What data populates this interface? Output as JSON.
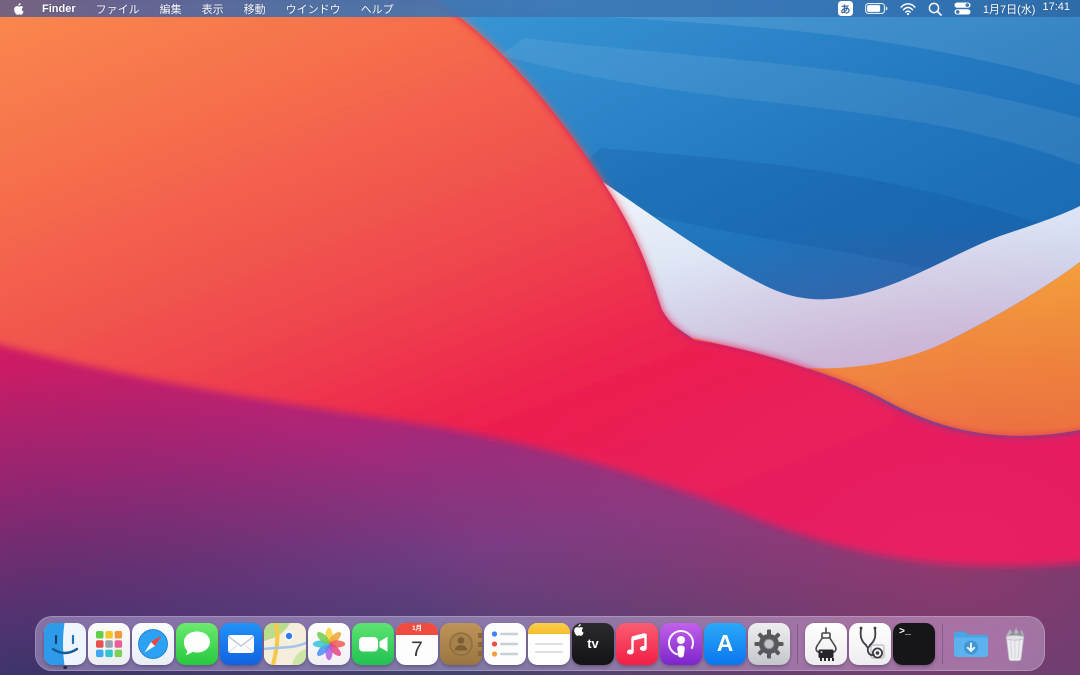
{
  "menu_bar": {
    "app_name": "Finder",
    "menus": [
      "ファイル",
      "編集",
      "表示",
      "移動",
      "ウインドウ",
      "ヘルプ"
    ],
    "status": {
      "input_source_label": "あ",
      "icons": [
        "battery-icon",
        "wifi-icon",
        "spotlight-search-icon",
        "control-center-icon"
      ],
      "battery_level_percent": 80,
      "date": "1月7日(水)",
      "time": "17:41"
    }
  },
  "dock": {
    "apps": [
      {
        "name": "Finder",
        "running": true
      },
      {
        "name": "Launchpad"
      },
      {
        "name": "Safari"
      },
      {
        "name": "Messages"
      },
      {
        "name": "Mail"
      },
      {
        "name": "Maps"
      },
      {
        "name": "Photos"
      },
      {
        "name": "FaceTime"
      },
      {
        "name": "Calendar"
      },
      {
        "name": "Contacts"
      },
      {
        "name": "Reminders"
      },
      {
        "name": "Notes"
      },
      {
        "name": "Apple TV"
      },
      {
        "name": "Music"
      },
      {
        "name": "Podcasts"
      },
      {
        "name": "App Store"
      },
      {
        "name": "System Preferences"
      },
      {
        "name": "Chip-claw custom app"
      },
      {
        "name": "Stethoscope custom app"
      },
      {
        "name": "Terminal"
      },
      {
        "name": "Downloads"
      },
      {
        "name": "Trash (full)"
      }
    ],
    "calendar_icon": {
      "month": "1月",
      "day": "7"
    },
    "terminal_icon_glyph": ">_",
    "tv_icon_text": "tv",
    "app_store_icon_letter": "A"
  },
  "wallpaper": {
    "name": "macOS Big Sur waves",
    "colors": {
      "blue": "#1f74ba",
      "white_band": "#e8eef9",
      "orange_band": "#f3a13a",
      "red_orange": "#f4694e",
      "crimson": "#ec1c4e",
      "magenta": "#c02073",
      "purple_bottom": "#454473"
    }
  }
}
